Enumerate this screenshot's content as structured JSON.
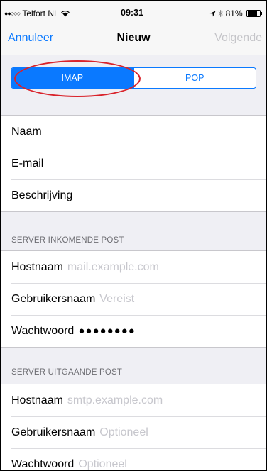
{
  "status_bar": {
    "signal": "●●○○○",
    "carrier": "Telfort NL",
    "wifi_icon": "wifi-icon",
    "time": "09:31",
    "location_icon": "location-arrow-icon",
    "bluetooth_icon": "bluetooth-icon",
    "battery_percent": "81%",
    "battery_level": 0.81
  },
  "nav": {
    "cancel_label": "Annuleer",
    "title": "Nieuw",
    "next_label": "Volgende"
  },
  "segmented": {
    "options": [
      "IMAP",
      "POP"
    ],
    "selected": "IMAP"
  },
  "account": {
    "name_label": "Naam",
    "email_label": "E-mail",
    "description_label": "Beschrijving"
  },
  "incoming": {
    "header": "SERVER INKOMENDE POST",
    "host_label": "Hostnaam",
    "host_placeholder": "mail.example.com",
    "user_label": "Gebruikersnaam",
    "user_placeholder": "Vereist",
    "password_label": "Wachtwoord",
    "password_value": "●●●●●●●●"
  },
  "outgoing": {
    "header": "SERVER UITGAANDE POST",
    "host_label": "Hostnaam",
    "host_placeholder": "smtp.example.com",
    "user_label": "Gebruikersnaam",
    "user_placeholder": "Optioneel",
    "password_label": "Wachtwoord",
    "password_placeholder": "Optioneel"
  },
  "colors": {
    "accent": "#0a79ff",
    "annotation": "#d9232b",
    "placeholder": "#c7c7cd",
    "background": "#efeff4"
  }
}
